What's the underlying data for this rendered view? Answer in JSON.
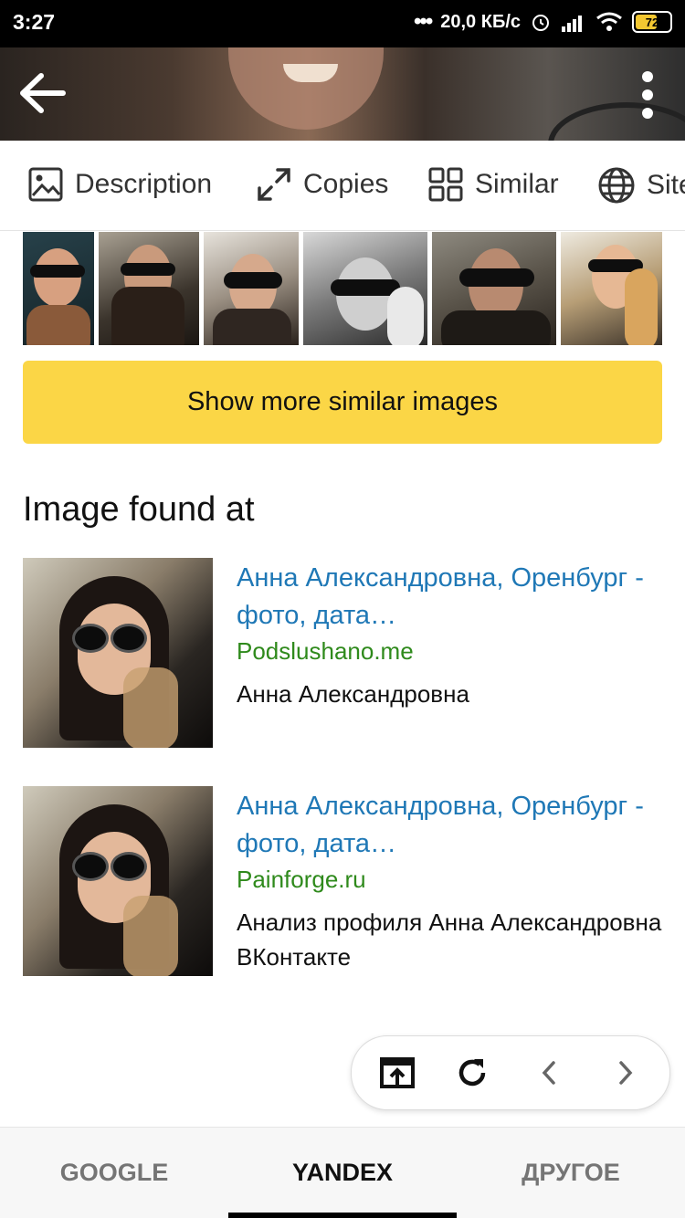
{
  "status_bar": {
    "time": "3:27",
    "network_speed": "20,0 КБ/с",
    "battery": "72",
    "battery_level": 0.72
  },
  "toolbar": {
    "back_icon": "arrow-left-icon",
    "more_icon": "more-vertical-icon"
  },
  "tabs": [
    {
      "label": "Description",
      "icon": "image-icon"
    },
    {
      "label": "Copies",
      "icon": "expand-arrows-icon"
    },
    {
      "label": "Similar",
      "icon": "grid-icon"
    },
    {
      "label": "Sites",
      "icon": "globe-icon"
    }
  ],
  "similar": {
    "button_label": "Show more similar images"
  },
  "found_at": {
    "title": "Image found at",
    "results": [
      {
        "title": "Анна Александровна, Оренбург - фото, дата…",
        "domain": "Podslushano.me",
        "description": "Анна Александровна"
      },
      {
        "title": "Анна Александровна, Оренбург - фото, дата…",
        "domain": "Painforge.ru",
        "description": "Анализ профиля Анна Александровна ВКонтакте"
      }
    ]
  },
  "floating_nav": {
    "icons": [
      "open-external-icon",
      "refresh-icon",
      "chevron-left-icon",
      "chevron-right-icon"
    ]
  },
  "bottom_tabs": {
    "items": [
      "GOOGLE",
      "YANDEX",
      "ДРУГОЕ"
    ],
    "active": "YANDEX"
  },
  "colors": {
    "accent_yellow": "#fbd646",
    "link_blue": "#1f78b6",
    "domain_green": "#2f8a1c"
  }
}
